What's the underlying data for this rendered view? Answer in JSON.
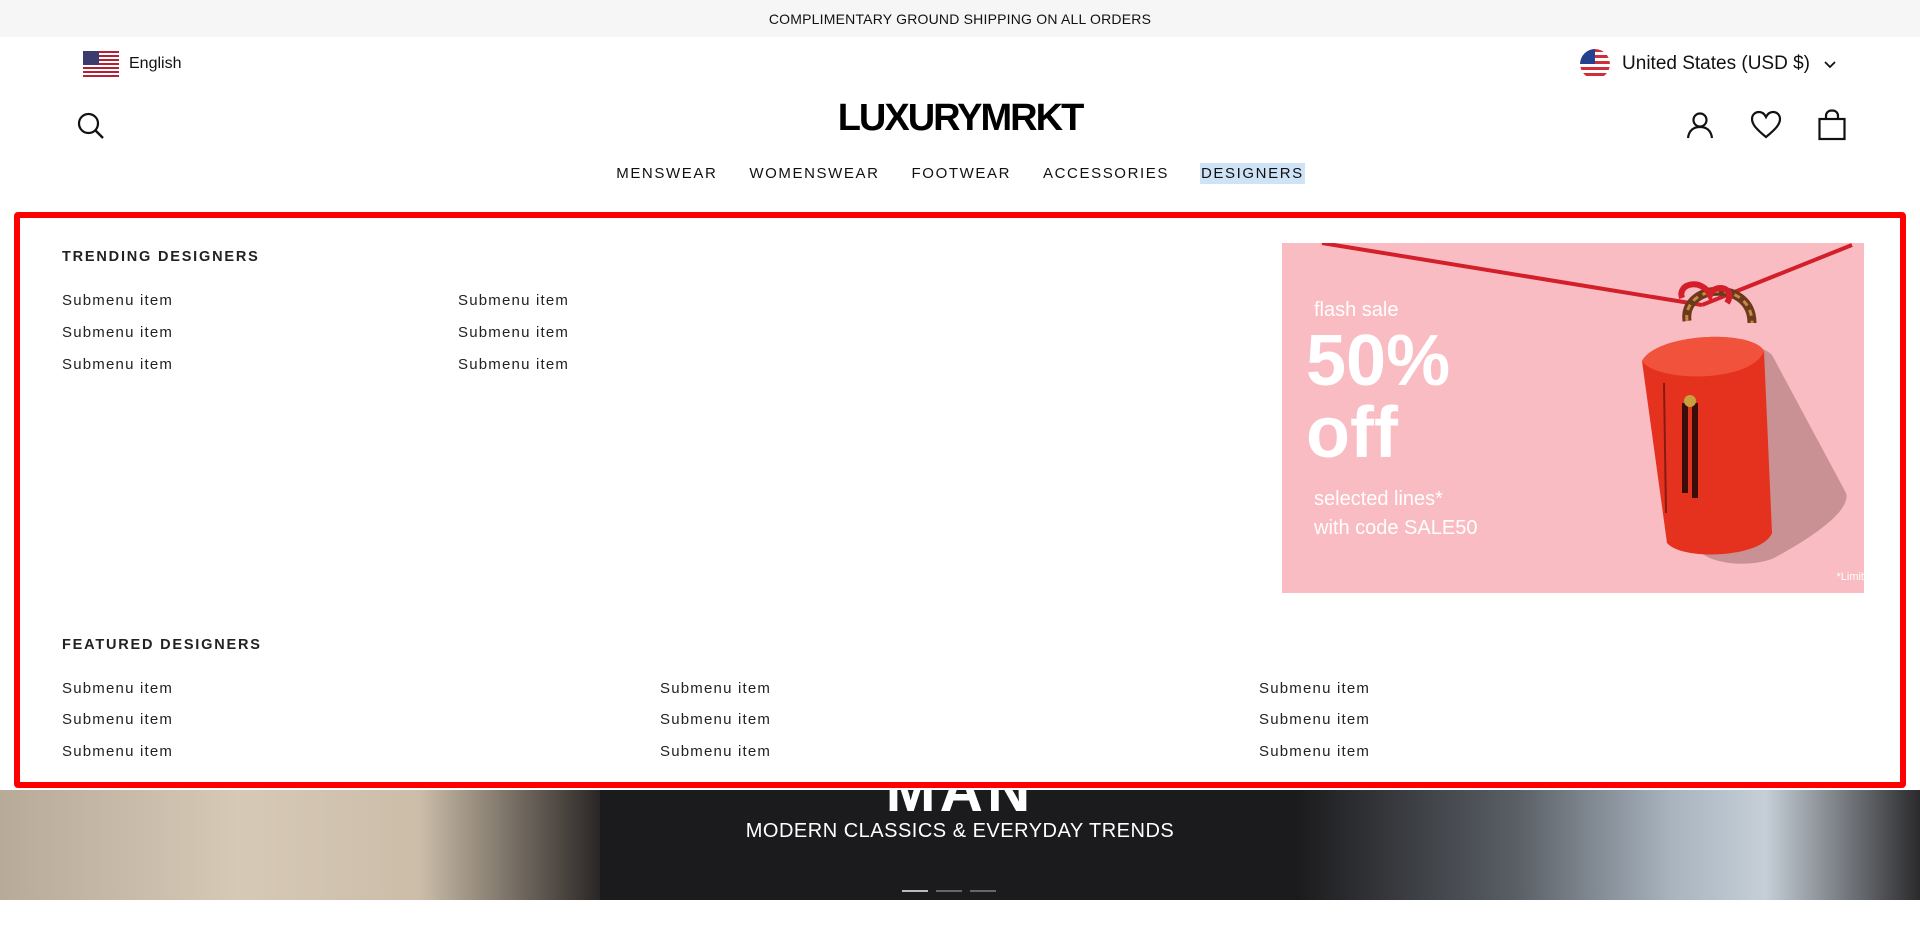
{
  "announcement": "COMPLIMENTARY GROUND SHIPPING ON ALL ORDERS",
  "language": {
    "label": "English",
    "flag_icon": "us-flag-icon"
  },
  "country": {
    "label": "United States (USD $)",
    "flag_icon": "us-round-flag-icon"
  },
  "logo": "LUXURYMRKT",
  "nav": [
    {
      "label": "MENSWEAR",
      "active": false
    },
    {
      "label": "WOMENSWEAR",
      "active": false
    },
    {
      "label": "FOOTWEAR",
      "active": false
    },
    {
      "label": "ACCESSORIES",
      "active": false
    },
    {
      "label": "DESIGNERS",
      "active": true
    }
  ],
  "header_icons": [
    "search-icon",
    "account-icon",
    "wishlist-heart-icon",
    "cart-bag-icon"
  ],
  "mega_menu": {
    "trending_heading": "TRENDING DESIGNERS",
    "trending_items": [
      "Submenu item",
      "Submenu item",
      "Submenu item",
      "Submenu item",
      "Submenu item",
      "Submenu item"
    ],
    "featured_heading": "FEATURED DESIGNERS",
    "featured_items": [
      "Submenu item",
      "Submenu item",
      "Submenu item",
      "Submenu item",
      "Submenu item",
      "Submenu item",
      "Submenu item",
      "Submenu item",
      "Submenu item"
    ],
    "promo": {
      "flash": "flash sale",
      "percent": "50%",
      "off": "off",
      "line1": "selected lines*",
      "line2": "with code SALE50",
      "fine": "*Limit"
    }
  },
  "hero": {
    "title": "MAN",
    "subtitle": "MODERN CLASSICS & EVERYDAY TRENDS"
  },
  "colors": {
    "announcement_bg": "#f6f6f6",
    "highlight_border": "#ff0000",
    "promo_bg": "#f9bcc2",
    "bag_red": "#e5321e",
    "active_nav_bg": "#cfe3f7"
  }
}
